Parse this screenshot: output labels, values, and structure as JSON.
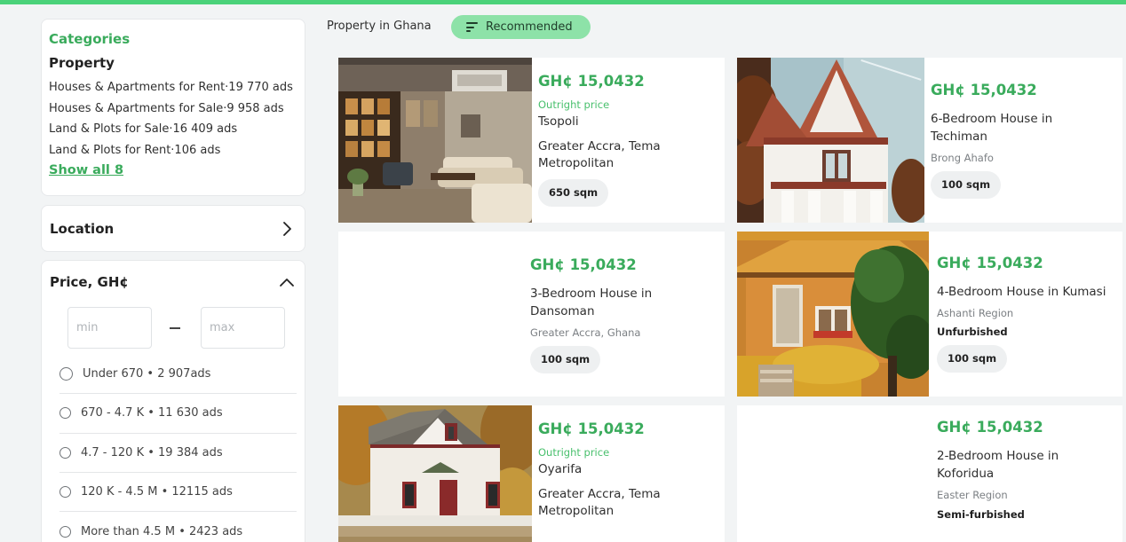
{
  "categories": {
    "title": "Categories",
    "group": "Property",
    "items": [
      "Houses & Apartments for Rent·19 770 ads",
      "Houses & Apartments for Sale·9 958 ads",
      "Land & Plots for Sale·16 409 ads",
      "Land & Plots for Rent·106 ads"
    ],
    "show_all": "Show all 8"
  },
  "location": {
    "label": "Location",
    "icon": "chevron-right-icon"
  },
  "price_filter": {
    "label": "Price, GH¢",
    "icon": "chevron-up-icon",
    "min_placeholder": "min",
    "max_placeholder": "max",
    "options": [
      "Under 670 • 2 907ads",
      "670 - 4.7 K • 11 630 ads",
      "4.7 - 120 K • 19 384 ads",
      "120 K - 4.5 M • 12115 ads",
      "More than 4.5 M • 2423 ads"
    ]
  },
  "header": {
    "breadcrumb": "Property in Ghana",
    "sort_label": "Recommended",
    "sort_icon": "sort-lines-icon"
  },
  "colors": {
    "accent": "#3aab5c",
    "topbar": "#4bd27a",
    "sort_bg": "#8de2a8"
  },
  "listings": [
    {
      "price": "GH¢ 15,0432",
      "subprice": "Outright price",
      "title": "Tsopoli",
      "location": "Greater Accra, Tema Metropolitan",
      "size": "650 sqm",
      "photo": "living-room-photo"
    },
    {
      "price": "GH¢ 15,0432",
      "title": "6-Bedroom House in Techiman",
      "region": "Brong Ahafo",
      "size": "100 sqm",
      "photo": "victorian-house-photo"
    },
    {
      "price": "GH¢ 15,0432",
      "title": "3-Bedroom House in Dansoman",
      "region": "Greater Accra, Ghana",
      "size": "100 sqm"
    },
    {
      "price": "GH¢ 15,0432",
      "title": "4-Bedroom House in Kumasi",
      "region": "Ashanti Region",
      "furnishing": "Unfurbished",
      "size": "100 sqm",
      "photo": "orange-house-photo"
    },
    {
      "price": "GH¢ 15,0432",
      "subprice": "Outright price",
      "title": "Oyarifa",
      "location": "Greater Accra, Tema Metropolitan",
      "photo": "cottage-house-photo"
    },
    {
      "price": "GH¢ 15,0432",
      "title": "2-Bedroom House in Koforidua",
      "region": "Easter Region",
      "furnishing": "Semi-furbished"
    }
  ]
}
